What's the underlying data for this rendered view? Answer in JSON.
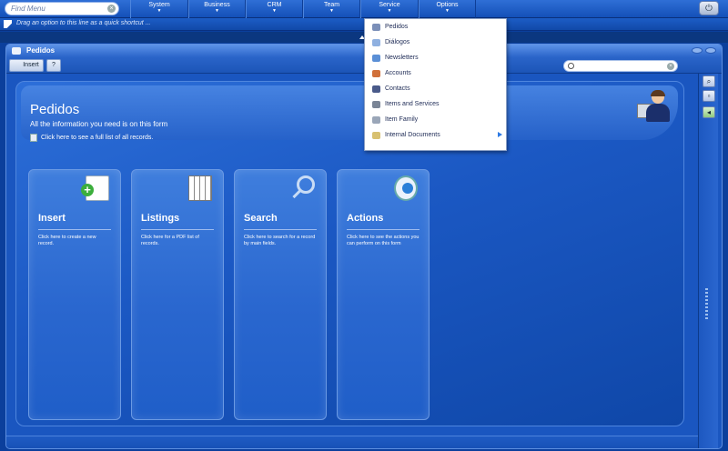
{
  "topbar": {
    "find_menu_placeholder": "Find Menu",
    "menus": [
      {
        "label": "System"
      },
      {
        "label": "Business"
      },
      {
        "label": "CRM"
      },
      {
        "label": "Team"
      },
      {
        "label": "Service"
      },
      {
        "label": "Options"
      }
    ]
  },
  "shortcut_hint": "Drag an option to this line as a quick shortcut ...",
  "window": {
    "title": "Pedidos",
    "toolbar": {
      "insert_label": "Insert",
      "help_label": "?"
    }
  },
  "header": {
    "title": "Pedidos",
    "subtitle": "All the information you need is on this form",
    "list_link": "Click here to see a full list of all records."
  },
  "cards": [
    {
      "title": "Insert",
      "desc": "Click here to create a new record.",
      "icon": "document-add-icon"
    },
    {
      "title": "Listings",
      "desc": "Click here for a PDF list of records.",
      "icon": "calendar-grid-icon"
    },
    {
      "title": "Search",
      "desc": "Click here to search for a record by main fields.",
      "icon": "magnifier-icon"
    },
    {
      "title": "Actions",
      "desc": "Click here to see the actions you can perform on this form",
      "icon": "play-icon"
    }
  ],
  "dropdown": {
    "items": [
      {
        "label": "Pedidos",
        "icon": "user-icon",
        "color": "#7b8fb8"
      },
      {
        "label": "Diálogos",
        "icon": "chat-icon",
        "color": "#8fb0e0"
      },
      {
        "label": "Newsletters",
        "icon": "mail-icon",
        "color": "#5a8fd6"
      },
      {
        "label": "Accounts",
        "icon": "group-icon",
        "color": "#d0703a"
      },
      {
        "label": "Contacts",
        "icon": "contact-icon",
        "color": "#4a5a8a"
      },
      {
        "label": "Items and Services",
        "icon": "items-icon",
        "color": "#7a8596"
      },
      {
        "label": "Item Family",
        "icon": "family-icon",
        "color": "#9aa6b8"
      },
      {
        "label": "Internal Documents",
        "icon": "documents-icon",
        "color": "#d8c070"
      }
    ]
  }
}
